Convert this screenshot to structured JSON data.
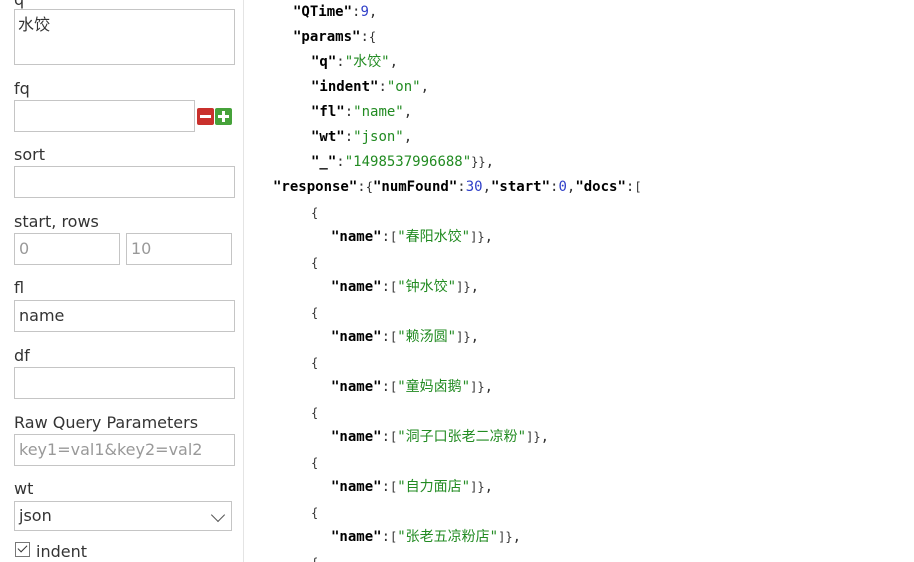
{
  "form": {
    "q_label": "q",
    "q_value": "水饺",
    "fq_label": "fq",
    "fq_value": "",
    "sort_label": "sort",
    "sort_value": "",
    "start_rows_label": "start, rows",
    "start_value": "0",
    "rows_value": "10",
    "fl_label": "fl",
    "fl_value": "name",
    "df_label": "df",
    "df_value": "",
    "raw_label": "Raw Query Parameters",
    "raw_placeholder": "key1=val1&key2=val2",
    "wt_label": "wt",
    "wt_value": "json",
    "indent_label": "indent",
    "indent_checked": true
  },
  "response": {
    "qtime_key": "\"QTime\"",
    "qtime_value": "9",
    "params_key": "\"params\"",
    "q_key": "\"q\"",
    "q_value": "\"水饺\"",
    "indent_key": "\"indent\"",
    "indent_value": "\"on\"",
    "fl_key": "\"fl\"",
    "fl_value": "\"name\"",
    "wt_key": "\"wt\"",
    "wt_value": "\"json\"",
    "underscore_key": "\"_\"",
    "underscore_value": "\"1498537996688\"",
    "response_key": "\"response\"",
    "numfound_key": "\"numFound\"",
    "numfound_value": "30",
    "start_key": "\"start\"",
    "start_value": "0",
    "docs_key": "\"docs\"",
    "name_key": "\"name\"",
    "docs": [
      {
        "name": "\"春阳水饺\""
      },
      {
        "name": "\"钟水饺\""
      },
      {
        "name": "\"赖汤圆\""
      },
      {
        "name": "\"童妈卤鹅\""
      },
      {
        "name": "\"洞子口张老二凉粉\""
      },
      {
        "name": "\"自力面店\""
      },
      {
        "name": "\"张老五凉粉店\""
      }
    ]
  }
}
